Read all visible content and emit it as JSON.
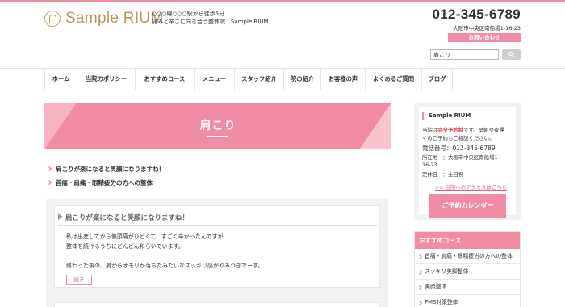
{
  "header": {
    "logo_text": "Sample RIUM",
    "tagline_line1": "○○○線○○○駅から徒歩5分",
    "tagline_line2": "痛みと辛さに向き合う整体院　Sample RIUM",
    "phone": "012-345-6789",
    "address": "大阪市中央区南船場1-16-23",
    "contact_label": "お問い合わせ",
    "search_value": "肩こり"
  },
  "nav": {
    "items": [
      {
        "label": "ホーム"
      },
      {
        "label": "当院のポリシー"
      },
      {
        "label": "おすすめコース"
      },
      {
        "label": "メニュー"
      },
      {
        "label": "スタッフ紹介"
      },
      {
        "label": "院の紹介"
      },
      {
        "label": "お客様の声"
      },
      {
        "label": "よくあるご質問"
      },
      {
        "label": "ブログ"
      }
    ]
  },
  "main": {
    "banner_title": "肩こり",
    "points": [
      "肩こりが楽になると笑顔になりますね！",
      "首痛・肩痛・眼精疲労の方への整体"
    ],
    "article": {
      "title": "肩こりが楽になると笑顔になりますね！",
      "line1": "私は出産してから偏頭痛がひどくて、すごく辛かったんですが",
      "line2": "整体を続けるうちにどんどん和らいでいます。",
      "line3": "終わった後の、肩からオモリが落ちたみたいなスッキリ感がやみつきでーす。",
      "more_label": "続き"
    }
  },
  "sidebar": {
    "info": {
      "title": "Sample RIUM",
      "line1_a": "当院は",
      "line1_b": "完全予約制",
      "line1_c": "です。早朝や夜遅",
      "line2": "くのご予約もご相談ください。",
      "phone_line": "電話番号：012-345-6789",
      "address_line1": "所在地　：大阪市中央区南船場1-",
      "address_line2": "16-23",
      "holiday_line": "定休日　：土日祝",
      "access_link": ">> 当院へのアクセスはこちら",
      "calendar_label": "ご予約カレンダー"
    },
    "recommend": {
      "title": "おすすめコース",
      "items": [
        {
          "label": "首痛・肩痛・眼精疲労の方への整体"
        },
        {
          "label": "スッキリ美脚整体"
        },
        {
          "label": "美顔整体"
        },
        {
          "label": "PMS対策整体"
        }
      ]
    }
  },
  "colors": {
    "accent": "#f28ca4",
    "gold": "#b9965e",
    "emphasis": "#e0304f"
  }
}
